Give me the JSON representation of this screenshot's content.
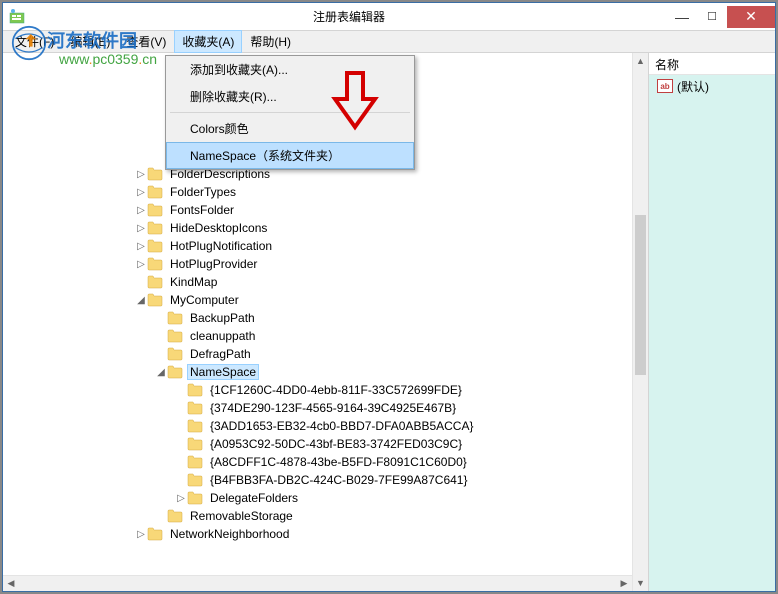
{
  "window": {
    "title": "注册表编辑器"
  },
  "menubar": {
    "file": "文件(F)",
    "edit": "编辑(E)",
    "view": "查看(V)",
    "favorites": "收藏夹(A)",
    "help": "帮助(H)"
  },
  "context_menu": {
    "add_favorite": "添加到收藏夹(A)...",
    "remove_favorite": "删除收藏夹(R)...",
    "colors": "Colors颜色",
    "namespace": "NameSpace（系统文件夹）"
  },
  "watermark": {
    "logo": "河东软件园",
    "url_left": "www",
    "url_mid": "pc0359",
    "url_right": "cn"
  },
  "tree": {
    "items": [
      {
        "indent": 132,
        "exp": "",
        "label": ""
      },
      {
        "indent": 132,
        "exp": "",
        "label": ""
      },
      {
        "indent": 132,
        "exp": "",
        "label": ""
      },
      {
        "indent": 132,
        "exp": "",
        "label": ""
      },
      {
        "indent": 132,
        "exp": "",
        "label": ""
      },
      {
        "indent": 132,
        "exp": "",
        "label": ""
      },
      {
        "indent": 132,
        "exp": "▷",
        "label": "FolderDescriptions"
      },
      {
        "indent": 132,
        "exp": "▷",
        "label": "FolderTypes"
      },
      {
        "indent": 132,
        "exp": "▷",
        "label": "FontsFolder"
      },
      {
        "indent": 132,
        "exp": "▷",
        "label": "HideDesktopIcons"
      },
      {
        "indent": 132,
        "exp": "▷",
        "label": "HotPlugNotification"
      },
      {
        "indent": 132,
        "exp": "▷",
        "label": "HotPlugProvider"
      },
      {
        "indent": 132,
        "exp": "",
        "label": "KindMap"
      },
      {
        "indent": 132,
        "exp": "◢",
        "label": "MyComputer"
      },
      {
        "indent": 152,
        "exp": "",
        "label": "BackupPath"
      },
      {
        "indent": 152,
        "exp": "",
        "label": "cleanuppath"
      },
      {
        "indent": 152,
        "exp": "",
        "label": "DefragPath"
      },
      {
        "indent": 152,
        "exp": "◢",
        "label": "NameSpace",
        "selected": true
      },
      {
        "indent": 172,
        "exp": "",
        "label": "{1CF1260C-4DD0-4ebb-811F-33C572699FDE}"
      },
      {
        "indent": 172,
        "exp": "",
        "label": "{374DE290-123F-4565-9164-39C4925E467B}"
      },
      {
        "indent": 172,
        "exp": "",
        "label": "{3ADD1653-EB32-4cb0-BBD7-DFA0ABB5ACCA}"
      },
      {
        "indent": 172,
        "exp": "",
        "label": "{A0953C92-50DC-43bf-BE83-3742FED03C9C}"
      },
      {
        "indent": 172,
        "exp": "",
        "label": "{A8CDFF1C-4878-43be-B5FD-F8091C1C60D0}"
      },
      {
        "indent": 172,
        "exp": "",
        "label": "{B4FBB3FA-DB2C-424C-B029-7FE99A87C641}"
      },
      {
        "indent": 172,
        "exp": "▷",
        "label": "DelegateFolders"
      },
      {
        "indent": 152,
        "exp": "",
        "label": "RemovableStorage"
      },
      {
        "indent": 132,
        "exp": "▷",
        "label": "NetworkNeighborhood"
      }
    ]
  },
  "right_pane": {
    "col_name": "名称",
    "default_value": "(默认)"
  }
}
